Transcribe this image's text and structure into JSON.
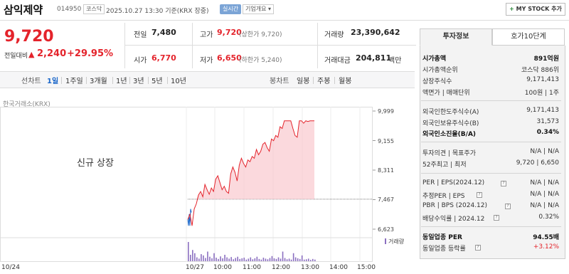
{
  "stock": {
    "name": "삼익제약",
    "code": "014950",
    "market": "코스닥",
    "datetime": "2025.10.27 13:30 기준(KRX 장중)",
    "realtime_badge": "실시간",
    "company_overview": "기업개요",
    "my_stock_button": "MY STOCK 추가"
  },
  "price": {
    "current": "9,720",
    "change_label": "전일대비",
    "change_arrow": "▲",
    "change": "2,240",
    "change_pct": "+29.95%"
  },
  "summary": {
    "prev_close_label": "전일",
    "prev_close": "7,480",
    "high_label": "고가",
    "high": "9,720",
    "high_sub": "(상한가 9,720)",
    "volume_label": "거래량",
    "volume": "23,390,642",
    "open_label": "시가",
    "open": "6,770",
    "low_label": "저가",
    "low": "6,650",
    "low_sub": "(하한가 5,240)",
    "trade_value_label": "거래대금",
    "trade_value": "204,811",
    "trade_value_unit": "백만"
  },
  "tabs": {
    "line_label": "선차트",
    "periods": [
      "1일",
      "1주일",
      "3개월",
      "1년",
      "3년",
      "5년",
      "10년"
    ],
    "selected_period": "1일",
    "candle_label": "봉차트",
    "candles": [
      "일봉",
      "주봉",
      "월봉"
    ]
  },
  "chart_meta": {
    "exchange": "한국거래소(KRX)",
    "annotation": "신규 상장",
    "volume_legend": "거래량"
  },
  "chart_data": {
    "type": "line",
    "x_ticks": [
      "10/24",
      "10/27",
      "10:00",
      "11:00",
      "12:00",
      "13:00",
      "14:00",
      "15:00"
    ],
    "y_ticks": [
      "9,999",
      "9,155",
      "8,311",
      "7,467",
      "6,623"
    ],
    "ylim": [
      6623,
      9999
    ],
    "reference_line": 7480,
    "series": [
      {
        "values": [
          6900,
          7050,
          6720,
          7200,
          7350,
          7600,
          7700,
          7550,
          7900,
          7750,
          7620,
          7800,
          7700,
          8050,
          8150,
          7950,
          7750,
          7850,
          7700,
          7650,
          8200,
          8400,
          8250,
          8000,
          8450,
          8650,
          8500,
          8400,
          8600,
          8550,
          8700,
          8650,
          8900,
          8750,
          8850,
          9050,
          9100,
          8950,
          8850,
          9200,
          9150,
          9300,
          9250,
          9550,
          9500,
          9720,
          9720,
          9720,
          9720,
          9500,
          9300,
          9250,
          9720,
          9720,
          9650,
          9720,
          9700,
          9720,
          9720,
          9720
        ]
      }
    ],
    "volume": [
      60,
      20,
      35,
      25,
      12,
      8,
      22,
      18,
      10,
      30,
      14,
      9,
      25,
      11,
      7,
      15,
      9,
      20,
      12,
      8,
      13,
      6,
      10,
      14,
      7,
      9,
      11,
      5,
      8,
      12,
      6,
      9,
      14,
      7,
      5,
      11,
      8,
      6,
      10,
      16,
      9,
      7,
      12,
      8,
      30,
      10,
      6,
      8,
      5,
      25,
      12,
      9,
      7,
      18,
      5,
      6,
      8,
      4,
      7,
      5
    ]
  },
  "right_panel": {
    "tabs": [
      "투자정보",
      "호가10단계"
    ],
    "active_tab": "투자정보",
    "rows": [
      {
        "label": "시가총액",
        "value": "891억원"
      },
      {
        "label": "시가총액순위",
        "value": "코스닥 886위"
      },
      {
        "label": "상장주식수",
        "value": "9,171,413"
      },
      {
        "label": "액면가 | 매매단위",
        "value": "100원 | 1주"
      },
      {
        "label": "외국인한도주식수(A)",
        "value": "9,171,413"
      },
      {
        "label": "외국인보유주식수(B)",
        "value": "31,573"
      },
      {
        "label": "외국인소진율(B/A)",
        "value": "0.34%"
      },
      {
        "label": "투자의견 | 목표주가",
        "value": "N/A | N/A"
      },
      {
        "label": "52주최고 | 최저",
        "value": "9,720 | 6,650"
      },
      {
        "label": "PER | EPS(2024.12)",
        "value": "N/A | N/A"
      },
      {
        "label": "추정PER | EPS",
        "value": "N/A | N/A"
      },
      {
        "label": "PBR | BPS (2024.12)",
        "value": "N/A | N/A"
      },
      {
        "label": "배당수익률 | 2024.12",
        "value": "0.32%"
      },
      {
        "label": "동일업종 PER",
        "value": "94.55배"
      },
      {
        "label": "동일업종 등락률",
        "value": "+3.12%"
      }
    ]
  },
  "colors": {
    "up": "#e4232b",
    "down": "#1a66c9",
    "accent": "#7ba4d6",
    "volume": "#8b6fc0"
  }
}
